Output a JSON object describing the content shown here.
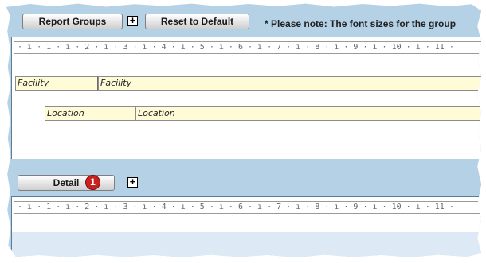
{
  "toolbar": {
    "report_groups_label": "Report Groups",
    "add_symbol": "+",
    "reset_label": "Reset to Default",
    "note_text": "* Please note: The font sizes for the group"
  },
  "ruler_text": "· ı · 1 · ı · 2 · ı · 3 · ı · 4 · ı · 5 · ı · 6 · ı · 7 · ı · 8 · ı · 9 · ı · 10 · ı · 11 ·",
  "groups": [
    {
      "label": "Facility",
      "value": "Facility"
    },
    {
      "label": "Location",
      "value": "Location"
    }
  ],
  "detail": {
    "label": "Detail",
    "badge": "1",
    "add_symbol": "+"
  }
}
